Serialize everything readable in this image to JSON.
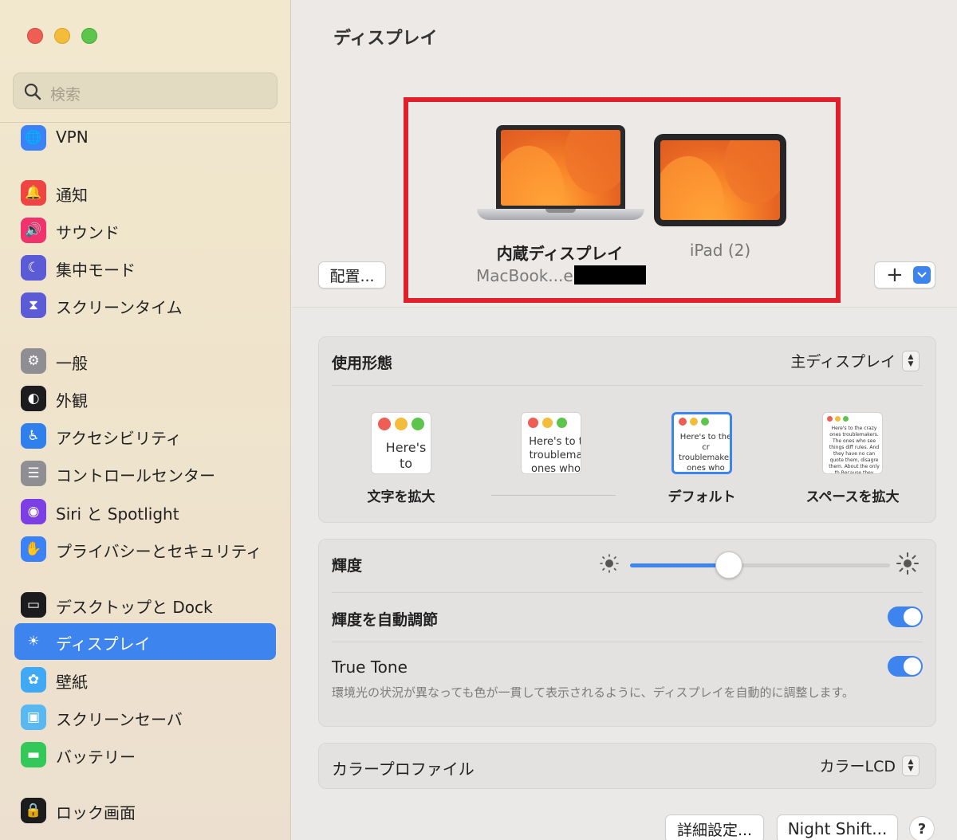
{
  "window": {
    "title": "ディスプレイ"
  },
  "search": {
    "placeholder": "検索"
  },
  "sidebar": {
    "items": [
      {
        "label": "VPN",
        "icon": "globe-icon",
        "color": "#3b82f6"
      },
      {
        "label": "通知",
        "icon": "bell-icon",
        "color": "#ef4444"
      },
      {
        "label": "サウンド",
        "icon": "speaker-icon",
        "color": "#f0336d"
      },
      {
        "label": "集中モード",
        "icon": "moon-icon",
        "color": "#5b5bd6"
      },
      {
        "label": "スクリーンタイム",
        "icon": "hourglass-icon",
        "color": "#5b5bd6"
      },
      {
        "label": "一般",
        "icon": "gear-icon",
        "color": "#8e8e93"
      },
      {
        "label": "外観",
        "icon": "appearance-icon",
        "color": "#1c1c1e"
      },
      {
        "label": "アクセシビリティ",
        "icon": "accessibility-icon",
        "color": "#2f80ed"
      },
      {
        "label": "コントロールセンター",
        "icon": "toggles-icon",
        "color": "#8e8e93"
      },
      {
        "label": "Siri と Spotlight",
        "icon": "siri-icon",
        "color": "#7b3fe4"
      },
      {
        "label": "プライバシーとセキュリティ",
        "icon": "hand-icon",
        "color": "#3b82f6"
      },
      {
        "label": "デスクトップと Dock",
        "icon": "dock-icon",
        "color": "#1c1c1e"
      },
      {
        "label": "ディスプレイ",
        "icon": "sun-icon",
        "color": "#3d84ee",
        "active": true
      },
      {
        "label": "壁紙",
        "icon": "flower-icon",
        "color": "#3fa9f5"
      },
      {
        "label": "スクリーンセーバ",
        "icon": "screensaver-icon",
        "color": "#5ab8f0"
      },
      {
        "label": "バッテリー",
        "icon": "battery-icon",
        "color": "#34c759"
      },
      {
        "label": "ロック画面",
        "icon": "lock-icon",
        "color": "#1c1c1e"
      }
    ]
  },
  "preview": {
    "arrange_label": "配置...",
    "builtin_name": "内蔵ディスプレイ",
    "builtin_sub": "MacBook...e",
    "ipad_name": "iPad (2)",
    "add_label": "+"
  },
  "usage": {
    "label": "使用形態",
    "value": "主ディスプレイ",
    "options": [
      {
        "caption": "文字を拡大",
        "preview_text": "Here's to troublem"
      },
      {
        "caption": "",
        "preview_text": "Here's to t troublema ones who"
      },
      {
        "caption": "デフォルト",
        "preview_text": "Here's to the cr troublemakers. ones who see t rules. And they",
        "selected": true
      },
      {
        "caption": "スペースを拡大",
        "preview_text": "Here's to the crazy ones troublemakers. The ones who see things diff rules. And they have no can quote them, disagre them. About the only th Because they change th"
      }
    ]
  },
  "brightness": {
    "label": "輝度",
    "value": 0.38
  },
  "auto_brightness": {
    "label": "輝度を自動調節",
    "on": true
  },
  "true_tone": {
    "label": "True Tone",
    "on": true,
    "description": "環境光の状況が異なっても色が一貫して表示されるように、ディスプレイを自動的に調整します。"
  },
  "color_profile": {
    "label": "カラープロファイル",
    "value": "カラーLCD"
  },
  "footer": {
    "advanced_label": "詳細設定...",
    "night_shift_label": "Night Shift...",
    "help_label": "?"
  },
  "colors": {
    "accent": "#3d84ee",
    "highlight_frame": "#e0202a"
  }
}
